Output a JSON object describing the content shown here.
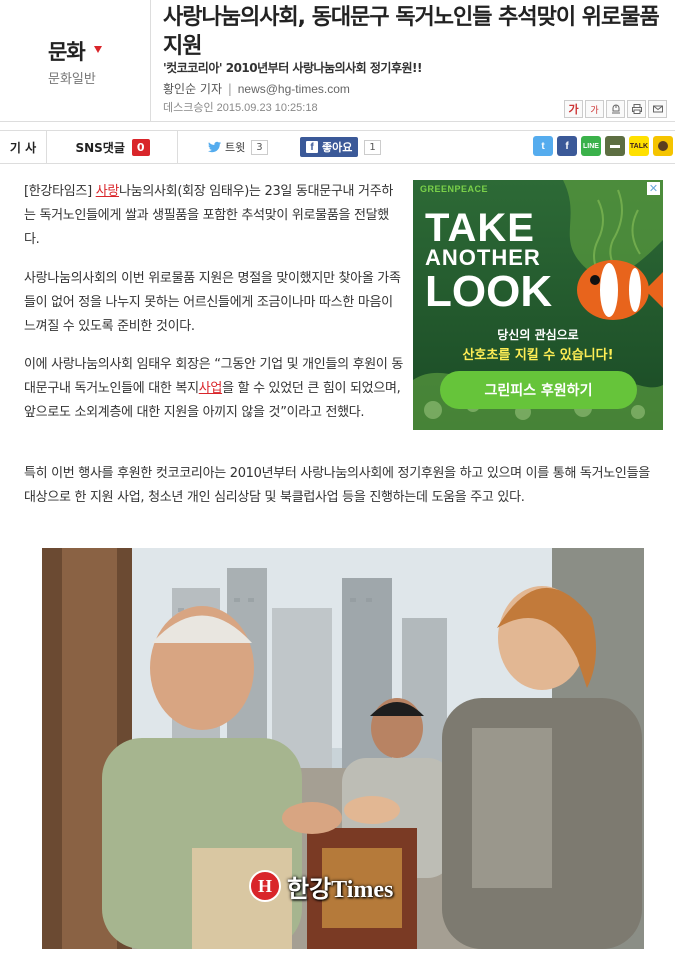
{
  "section": {
    "title": "문화",
    "subtitle": "문화일반"
  },
  "article": {
    "headline": "사랑나눔의사회, 동대문구 독거노인들 추석맞이 위로물품 지원",
    "subhead": "'컷코코리아' 2010년부터 사랑나눔의사회 정기후원!!",
    "reporter": "황인순 기자",
    "email": "news@hg-times.com",
    "dateline": "데스크승인 2015.09.23  10:25:18",
    "p1_prefix": "[한강타임즈] ",
    "p1_link": "사랑",
    "p1_rest": "나눔의사회(회장 임태우)는 23일 동대문구내 거주하는 독거노인들에게 쌀과 생필품을 포함한 추석맞이 위로물품을 전달했다.",
    "p2": "사랑나눔의사회의 이번 위로물품 지원은 명절을 맞이했지만 찾아올 가족들이 없어 정을 나누지 못하는 어르신들에게 조금이나마 따스한 마음이 느껴질 수 있도록 준비한 것이다.",
    "p3_a": "이에 사랑나눔의사회 임태우 회장은 “그동안 기업 및 개인들의 후원이 동대문구내 독거노인들에 대한 복지",
    "p3_link": "사업",
    "p3_b": "을 할 수 있었던 큰 힘이 되었으며, 앞으로도 소외계층에 대한 지원을 아끼지 않을 것”이라고 전했다.",
    "p4": "특히 이번 행사를 후원한 컷코코리아는 2010년부터 사랑나눔의사회에 정기후원을 하고 있으며 이를 통해 독거노인들을 대상으로 한 지원 사업, 청소년 개인 심리상담 및 북클럽사업 등을 진행하는데 도움을 주고 있다."
  },
  "tools": [
    "가",
    "가"
  ],
  "tabs": {
    "article": "기 사",
    "sns": "SNS댓글",
    "sns_count": "0"
  },
  "social": {
    "tweet_label": "트윗",
    "tweet_count": "3",
    "like_label": "좋아요",
    "like_count": "1"
  },
  "ad": {
    "brand": "GREENPEACE",
    "close": "✕",
    "take": "TAKE",
    "another": "ANOTHER",
    "look": "LOOK",
    "line1": "당신의 관심으로",
    "line2_hl": "산호초를 지킬 수 있습니다!",
    "button": "그린피스 후원하기"
  },
  "photo": {
    "logo_text": "한강Times",
    "logo_mark": "H"
  },
  "colors": {
    "accent": "#d9252a",
    "ad_bg": "#1e5a2e",
    "ad_button": "#66c43a",
    "facebook": "#3b5998"
  }
}
